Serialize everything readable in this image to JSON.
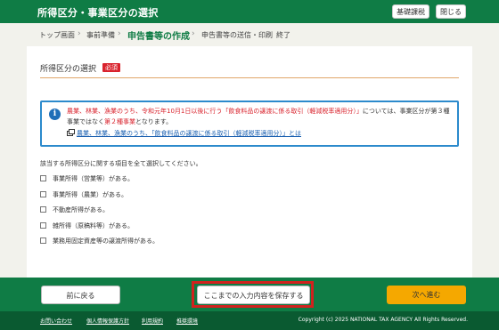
{
  "header": {
    "title": "所得区分・事業区分の選択",
    "glossary_button": "基礎課税",
    "close_button": "閉じる"
  },
  "steps": {
    "items": [
      {
        "label": "トップ画面",
        "current": false
      },
      {
        "label": "事前準備",
        "current": false
      },
      {
        "label": "申告書等の作成",
        "current": true
      },
      {
        "label": "申告書等の送信・印刷",
        "current": false
      },
      {
        "label": "終了",
        "current": false
      }
    ],
    "separator": "›"
  },
  "section": {
    "title": "所得区分の選択",
    "required_badge": "必須"
  },
  "notice": {
    "icon": "info-icon",
    "line1_red": "農業、林業、漁業のうち、令和元年10月1日以後に行う「飲食料品の譲渡に係る取引（軽減税率適用分）」",
    "line1_tail": "については、事業区分が第３種",
    "line2_head": "事業ではなく",
    "line2_red": "第２種事業",
    "line2_tail": "となります。",
    "link": "農業、林業、漁業のうち、「飲食料品の譲渡に係る取引（軽減税率適用分）」とは"
  },
  "instruction": "該当する所得区分に関する項目を全て選択してください。",
  "options": [
    {
      "label": "事業所得（営業等）がある。",
      "checked": false
    },
    {
      "label": "事業所得（農業）がある。",
      "checked": false
    },
    {
      "label": "不動産所得がある。",
      "checked": false
    },
    {
      "label": "雑所得（原稿料等）がある。",
      "checked": false
    },
    {
      "label": "業務用固定資産等の譲渡所得がある。",
      "checked": false
    }
  ],
  "actions": {
    "back": "前に戻る",
    "save": "ここまでの入力内容を保存する",
    "next": "次へ進む"
  },
  "footer": {
    "links": [
      "お問い合わせ",
      "個人情報保護方針",
      "利用規約",
      "推奨環境"
    ],
    "copyright": "Copyright (c) 2025 NATIONAL TAX AGENCY All Rights Reserved."
  },
  "colors": {
    "primary_green": "#0f7c45",
    "footer_green": "#0a5a31",
    "required_red": "#d9232d",
    "notice_border": "#2c8acc",
    "next_button": "#f5a800",
    "highlight_outline": "#d2221e"
  }
}
